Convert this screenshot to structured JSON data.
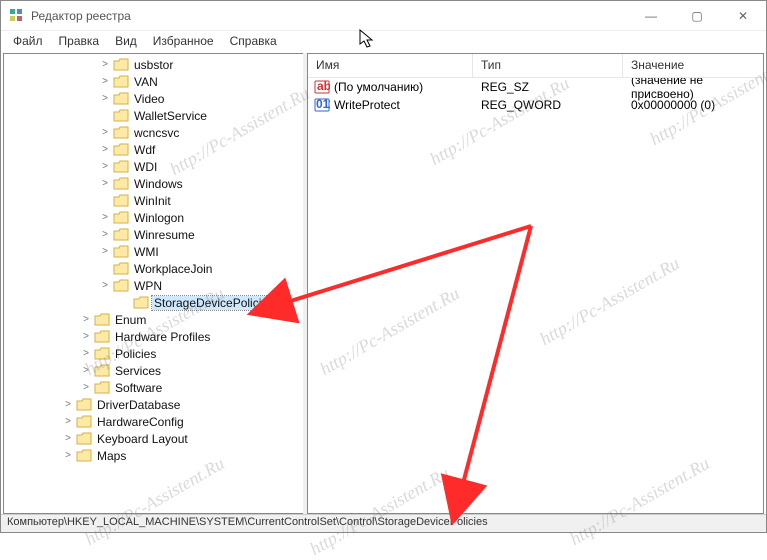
{
  "window": {
    "title": "Редактор реестра",
    "controls": {
      "min": "—",
      "max": "▢",
      "close": "✕"
    }
  },
  "menu": [
    "Файл",
    "Правка",
    "Вид",
    "Избранное",
    "Справка"
  ],
  "tree": {
    "items": [
      {
        "label": "usbstor",
        "level": "b",
        "expander": ">"
      },
      {
        "label": "VAN",
        "level": "b",
        "expander": ">"
      },
      {
        "label": "Video",
        "level": "b",
        "expander": ">"
      },
      {
        "label": "WalletService",
        "level": "b",
        "expander": ""
      },
      {
        "label": "wcncsvc",
        "level": "b",
        "expander": ">"
      },
      {
        "label": "Wdf",
        "level": "b",
        "expander": ">"
      },
      {
        "label": "WDI",
        "level": "b",
        "expander": ">"
      },
      {
        "label": "Windows",
        "level": "b",
        "expander": ">"
      },
      {
        "label": "WinInit",
        "level": "b",
        "expander": ""
      },
      {
        "label": "Winlogon",
        "level": "b",
        "expander": ">"
      },
      {
        "label": "Winresume",
        "level": "b",
        "expander": ">"
      },
      {
        "label": "WMI",
        "level": "b",
        "expander": ">"
      },
      {
        "label": "WorkplaceJoin",
        "level": "b",
        "expander": ""
      },
      {
        "label": "WPN",
        "level": "b",
        "expander": ">"
      },
      {
        "label": "StorageDevicePolicies",
        "level": "c",
        "expander": "",
        "selected": true
      },
      {
        "label": "Enum",
        "level": "a",
        "expander": ">"
      },
      {
        "label": "Hardware Profiles",
        "level": "a",
        "expander": ">"
      },
      {
        "label": "Policies",
        "level": "a",
        "expander": ">"
      },
      {
        "label": "Services",
        "level": "a",
        "expander": ">"
      },
      {
        "label": "Software",
        "level": "a",
        "expander": ">"
      },
      {
        "label": "DriverDatabase",
        "level": "top",
        "expander": ">"
      },
      {
        "label": "HardwareConfig",
        "level": "top",
        "expander": ">"
      },
      {
        "label": "Keyboard Layout",
        "level": "top",
        "expander": ">"
      },
      {
        "label": "Maps",
        "level": "top",
        "expander": ">"
      }
    ]
  },
  "list": {
    "headers": {
      "name": "Имя",
      "type": "Тип",
      "value": "Значение"
    },
    "rows": [
      {
        "icon": "ab",
        "name": "(По умолчанию)",
        "type": "REG_SZ",
        "value": "(значение не присвоено)"
      },
      {
        "icon": "bin",
        "name": "WriteProtect",
        "type": "REG_QWORD",
        "value": "0x00000000 (0)"
      }
    ]
  },
  "statusbar": "Компьютер\\HKEY_LOCAL_MACHINE\\SYSTEM\\CurrentControlSet\\Control\\StorageDevicePolicies",
  "watermark": "http://Pc-Assistent.Ru"
}
